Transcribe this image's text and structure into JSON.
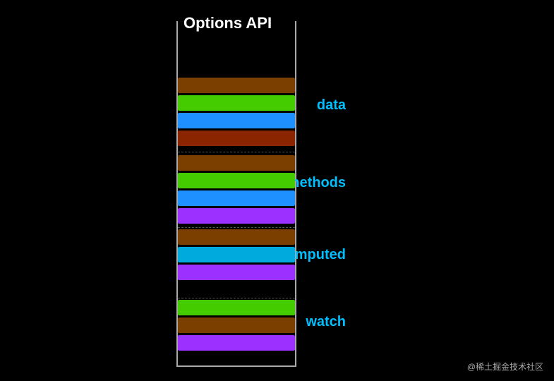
{
  "title": "Options API",
  "sections": [
    {
      "id": "data",
      "label": "data",
      "bars": [
        {
          "color": "#7B3F00"
        },
        {
          "color": "#44CC00"
        },
        {
          "color": "#1E90FF"
        },
        {
          "color": "#8B2500"
        }
      ]
    },
    {
      "id": "methods",
      "label": "methods",
      "bars": [
        {
          "color": "#7B3F00"
        },
        {
          "color": "#44CC00"
        },
        {
          "color": "#1E90FF"
        },
        {
          "color": "#9B30FF"
        }
      ]
    },
    {
      "id": "computed",
      "label": "computed",
      "bars": [
        {
          "color": "#7B3F00"
        },
        {
          "color": "#00AADD"
        },
        {
          "color": "#9B30FF"
        }
      ]
    },
    {
      "id": "watch",
      "label": "watch",
      "bars": [
        {
          "color": "#44CC00"
        },
        {
          "color": "#7B3F00"
        },
        {
          "color": "#9B30FF"
        }
      ]
    }
  ],
  "watermark": "@稀土掘金技术社区"
}
